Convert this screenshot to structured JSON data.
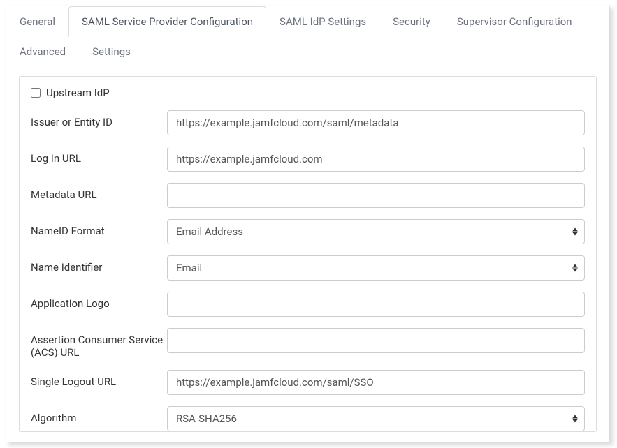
{
  "tabs": {
    "row1": {
      "general": "General",
      "saml_sp": "SAML Service Provider Configuration",
      "saml_idp": "SAML IdP Settings",
      "security": "Security",
      "supervisor": "Supervisor Configuration"
    },
    "row2": {
      "advanced": "Advanced",
      "settings": "Settings"
    }
  },
  "form": {
    "upstream_idp": {
      "label": "Upstream IdP",
      "checked": false
    },
    "issuer": {
      "label": "Issuer or Entity ID",
      "value": "https://example.jamfcloud.com/saml/metadata"
    },
    "login_url": {
      "label": "Log In URL",
      "value": "https://example.jamfcloud.com"
    },
    "metadata_url": {
      "label": "Metadata URL",
      "value": ""
    },
    "nameid_format": {
      "label": "NameID Format",
      "value": "Email Address"
    },
    "name_identifier": {
      "label": "Name Identifier",
      "value": "Email"
    },
    "app_logo": {
      "label": "Application Logo",
      "value": ""
    },
    "acs_url": {
      "label": "Assertion Consumer Service (ACS) URL",
      "value": ""
    },
    "slo_url": {
      "label": "Single Logout URL",
      "value": "https://example.jamfcloud.com/saml/SSO"
    },
    "algorithm": {
      "label": "Algorithm",
      "value": "RSA-SHA256"
    }
  }
}
